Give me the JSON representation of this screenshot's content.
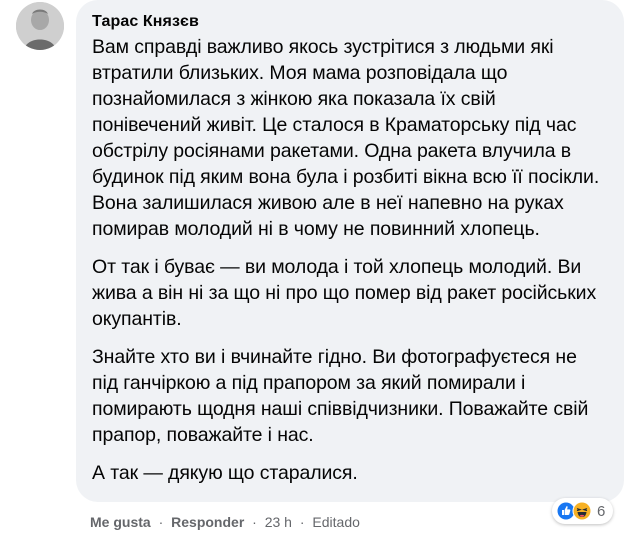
{
  "comment": {
    "author": "Тарас Князєв",
    "paragraphs": [
      "Вам справді важливо якось зустрітися з людьми які втратили близьких. Моя мама розповідала що познайомилася з жінкою яка показала їх свій понівечений живіт. Це сталося в Краматорську під час обстрілу росіянами ракетами. Одна ракета влучила в будинок під яким вона була і розбиті вікна всю її посікли. Вона залишилася живою але в неї напевно на руках помирав молодий ні в чому не повинний хлопець.",
      "От так і буває — ви молода і той хлопець молодий. Ви жива а він ні за що ні про що помер від ракет російських окупантів.",
      "Знайте хто ви і вчинайте гідно. Ви фотографуєтеся не під ганчіркою а під прапором за який помирали і помирають щодня наші співвідчизники. Поважайте свій прапор, поважайте і нас.",
      "А так — дякую що старалися."
    ]
  },
  "footer": {
    "like_label": "Me gusta",
    "separator": "·",
    "reply_label": "Responder",
    "time": "23 h",
    "edited": "Editado"
  },
  "reactions": {
    "icons": [
      "like-icon",
      "haha-icon"
    ],
    "count": "6",
    "colors": {
      "like": "#1877f2",
      "haha": "#f7b125"
    }
  }
}
